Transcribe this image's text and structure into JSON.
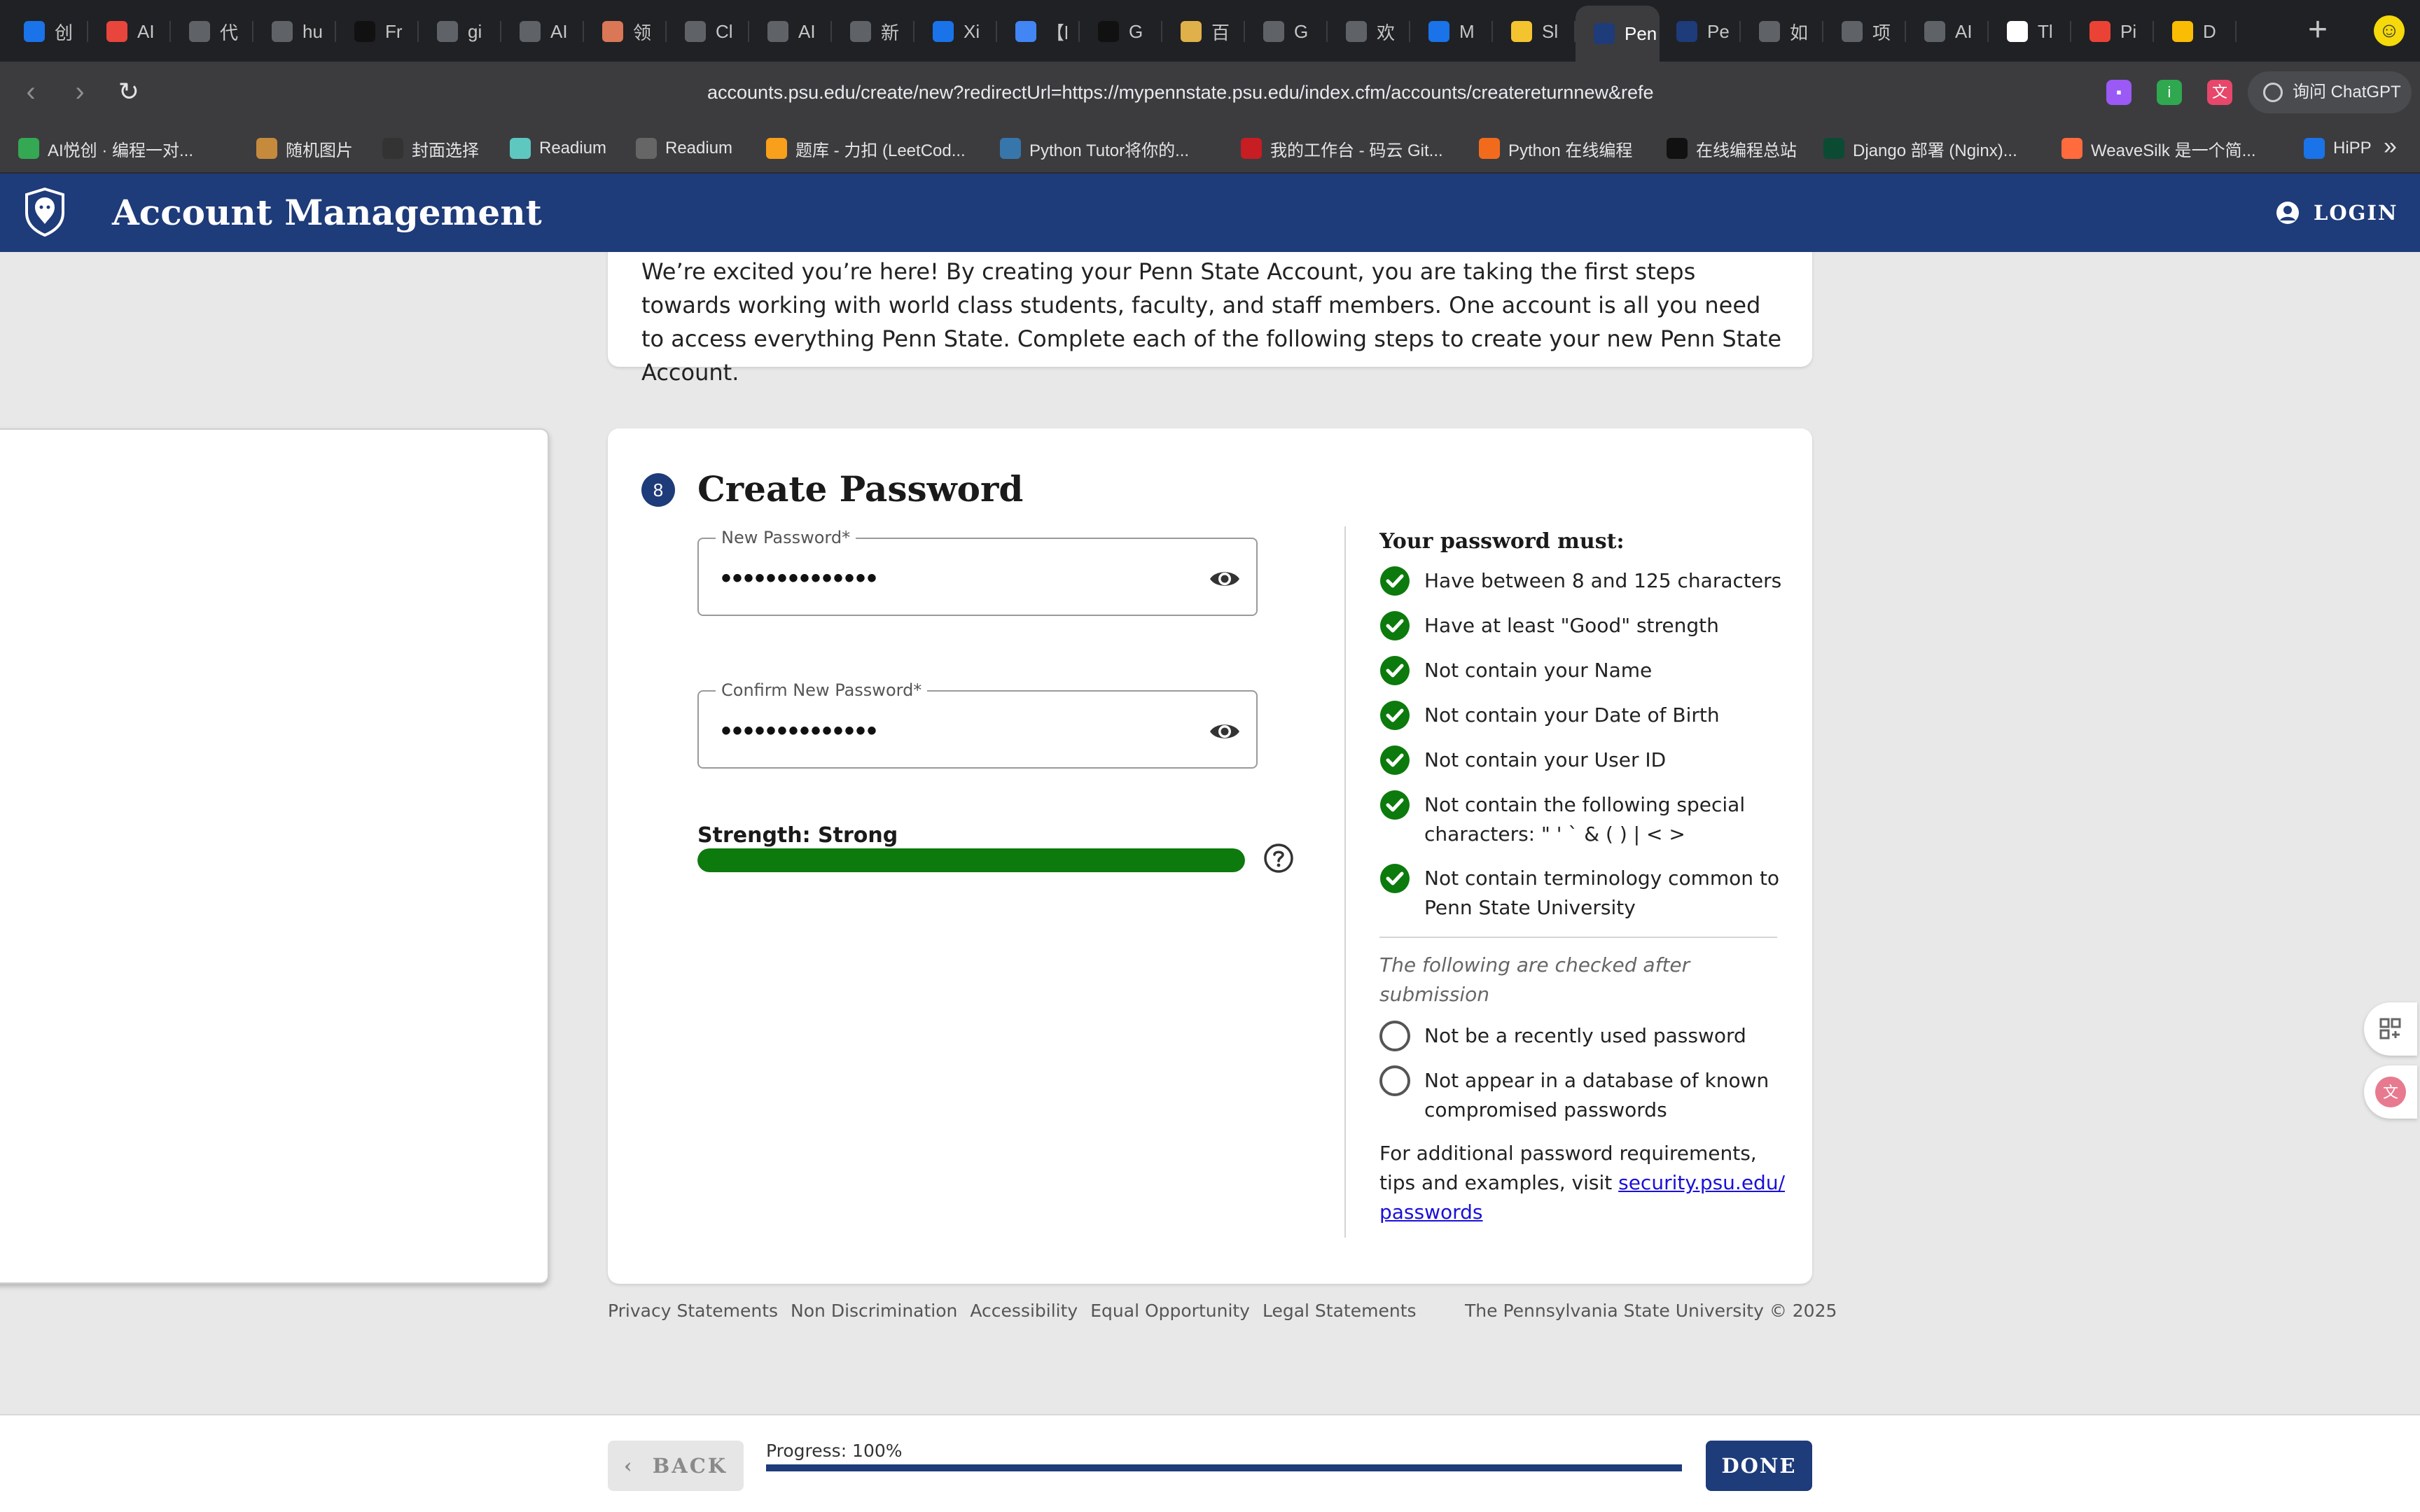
{
  "browser": {
    "tabs": [
      {
        "title": "创",
        "icon": "calendar-icon",
        "color": "#1a73e8"
      },
      {
        "title": "AI",
        "icon": "ai-icon",
        "color": "#e8453c"
      },
      {
        "title": "代",
        "icon": "openai-icon",
        "color": "#5f6368"
      },
      {
        "title": "hu",
        "icon": "github-icon",
        "color": "#5f6368"
      },
      {
        "title": "Fr",
        "icon": "smile-icon",
        "color": "#111111"
      },
      {
        "title": "gi",
        "icon": "github-icon",
        "color": "#5f6368"
      },
      {
        "title": "AI",
        "icon": "github-icon",
        "color": "#5f6368"
      },
      {
        "title": "领",
        "icon": "claude-icon",
        "color": "#d97757"
      },
      {
        "title": "Cl",
        "icon": "openai-icon",
        "color": "#5f6368"
      },
      {
        "title": "AI",
        "icon": "github-icon",
        "color": "#5f6368"
      },
      {
        "title": "新",
        "icon": "openai-icon",
        "color": "#5f6368"
      },
      {
        "title": "Xi",
        "icon": "tv-icon",
        "color": "#1a73e8"
      },
      {
        "title": "【l",
        "icon": "doc-icon",
        "color": "#4285f4"
      },
      {
        "title": "G",
        "icon": "g-icon",
        "color": "#111111"
      },
      {
        "title": "百",
        "icon": "note-icon",
        "color": "#e0b04a"
      },
      {
        "title": "G",
        "icon": "g-icon",
        "color": "#5f6368"
      },
      {
        "title": "欢",
        "icon": "sync-icon",
        "color": "#5f6368"
      },
      {
        "title": "M",
        "icon": "m-icon",
        "color": "#1a73e8"
      },
      {
        "title": "Sl",
        "icon": "slide-icon",
        "color": "#f4c430"
      },
      {
        "title": "Pen",
        "icon": "psu-shield-icon",
        "color": "#1e3b7a",
        "active": true
      },
      {
        "title": "Pe",
        "icon": "psu-shield-icon",
        "color": "#1e3b7a"
      },
      {
        "title": "如",
        "icon": "openai-icon",
        "color": "#5f6368"
      },
      {
        "title": "项",
        "icon": "openai-icon",
        "color": "#5f6368"
      },
      {
        "title": "AI",
        "icon": "github-icon",
        "color": "#5f6368"
      },
      {
        "title": "Tl",
        "icon": "t-icon",
        "color": "#ffffff"
      },
      {
        "title": "Pi",
        "icon": "gmail-icon",
        "color": "#ea4335"
      },
      {
        "title": "D",
        "icon": "d-icon",
        "color": "#fbbc04"
      }
    ],
    "new_tab_symbol": "+",
    "url": "accounts.psu.edu/create/new?redirectUrl=https://mypennstate.psu.edu/index.cfm/accounts/createreturnnew&refe",
    "chatgpt_label": "询问 ChatGPT",
    "bookmarks": [
      {
        "label": "AI悦创 · 编程一对...",
        "icon": "aiyc-icon",
        "color": "#34a853"
      },
      {
        "label": "随机图片",
        "icon": "box-icon",
        "color": "#c58a3c"
      },
      {
        "label": "封面选择",
        "icon": "cover-icon",
        "color": "#333333"
      },
      {
        "label": "Readium",
        "icon": "readium-icon",
        "color": "#5ec7c0"
      },
      {
        "label": "Readium",
        "icon": "readium2-icon",
        "color": "#666666"
      },
      {
        "label": "题库 - 力扣 (LeetCod...",
        "icon": "leetcode-icon",
        "color": "#f89f1b"
      },
      {
        "label": "Python Tutor将你的...",
        "icon": "python-icon",
        "color": "#3776ab"
      },
      {
        "label": "我的工作台 - 码云 Git...",
        "icon": "gitee-icon",
        "color": "#c71d23"
      },
      {
        "label": "Python 在线编程",
        "icon": "python-online-icon",
        "color": "#f26b1d"
      },
      {
        "label": "在线编程总站",
        "icon": "code-icon",
        "color": "#111111"
      },
      {
        "label": "Django 部署 (Nginx)...",
        "icon": "django-icon",
        "color": "#0c4b33"
      },
      {
        "label": "WeaveSilk 是一个简...",
        "icon": "weavesilk-icon",
        "color": "#ff6b3d"
      },
      {
        "label": "HiPP",
        "icon": "p-icon",
        "color": "#1a73e8"
      }
    ]
  },
  "header": {
    "title": "Account Management",
    "login_label": "LOGIN"
  },
  "intro": {
    "text": "We’re excited you’re here! By creating your Penn State Account, you are taking the first steps towards working with world class students, faculty, and staff members. One account is all you need to access everything Penn State. Complete each of the following steps to create your new Penn State Account."
  },
  "step": {
    "number": "8",
    "title": "Create Password",
    "new_password_label": "New Password*",
    "new_password_value": "••••••••••••••",
    "confirm_password_label": "Confirm New Password*",
    "confirm_password_value": "••••••••••••••",
    "strength_label": "Strength: Strong",
    "strength_fraction": 1.0,
    "strength_color": "#0c7a0c"
  },
  "requirements": {
    "title": "Your password must:",
    "met": [
      "Have between 8 and 125 characters",
      "Have at least \"Good\" strength",
      "Not contain your Name",
      "Not contain your Date of Birth",
      "Not contain your User ID",
      "Not contain the following special characters: \" ' ` & ( ) | < >",
      "Not contain terminology common to Penn State University"
    ],
    "after_note": "The following are checked after submission",
    "after": [
      "Not be a recently used password",
      "Not appear in a database of known compromised passwords"
    ],
    "more_text": "For additional password requirements, tips and examples, visit ",
    "more_link": "security.psu.edu/ passwords"
  },
  "footer": {
    "links": [
      "Privacy Statements",
      "Non Discrimination",
      "Accessibility",
      "Equal Opportunity",
      "Legal Statements"
    ],
    "copyright": "The Pennsylvania State University © 2025"
  },
  "bottom": {
    "back_label": "BACK",
    "progress_label": "Progress: 100%",
    "progress_fraction": 1.0,
    "done_label": "DONE"
  },
  "colors": {
    "brand": "#1e3b7a",
    "success": "#0c7a0c",
    "link": "#1a10d8"
  }
}
